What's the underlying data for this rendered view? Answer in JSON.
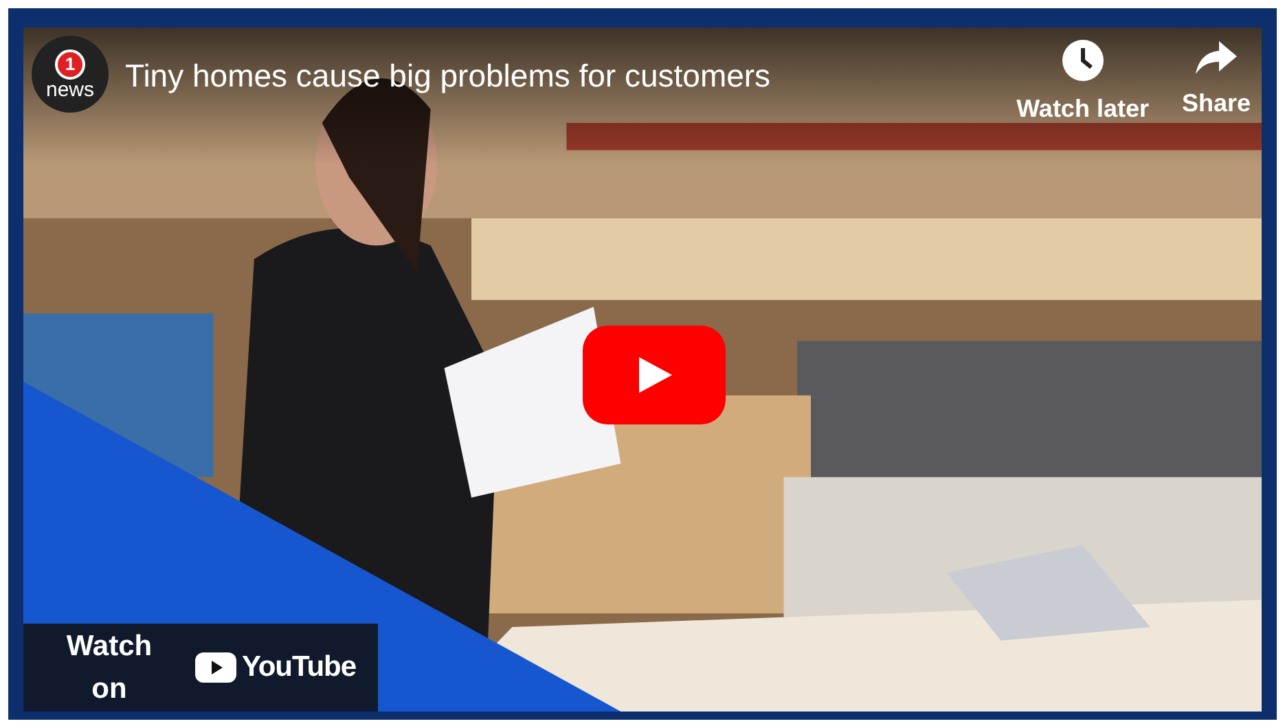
{
  "video": {
    "kind": "picture",
    "channel_logo": {
      "number": "1",
      "text": "news"
    },
    "title": "Tiny homes cause big problems for customers",
    "actions": [
      {
        "kind": "clock",
        "label": "Watch later"
      },
      {
        "kind": "share",
        "label": "Share"
      }
    ],
    "watch_on": {
      "text": "Watch on",
      "brand": "YouTube"
    }
  }
}
